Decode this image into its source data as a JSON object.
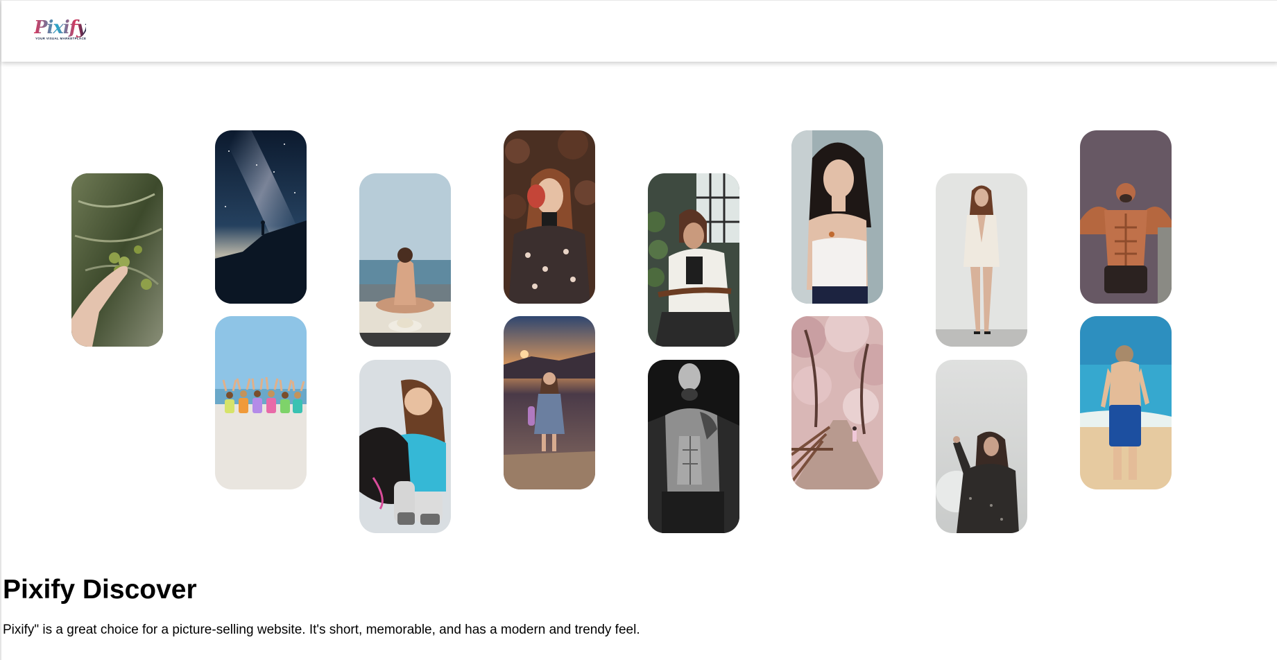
{
  "header": {
    "logo_text": "Pixify",
    "logo_tagline": "YOUR VISUAL MARKETPLACE",
    "logo_icon": "pixify-logo"
  },
  "gallery": {
    "photos": [
      {
        "name": "photo-olive-hand",
        "depicts": "hand holding olives"
      },
      {
        "name": "photo-milky-way",
        "depicts": "person under starry sky"
      },
      {
        "name": "photo-beach-kids",
        "depicts": "children raising arms on beach"
      },
      {
        "name": "photo-woman-beach-hat",
        "depicts": "woman sitting on beach with hat"
      },
      {
        "name": "photo-girl-dog",
        "depicts": "girl hugging dog"
      },
      {
        "name": "photo-woman-leaf",
        "depicts": "woman holding red leaf"
      },
      {
        "name": "photo-girl-field-sunset",
        "depicts": "little girl in field at sunset"
      },
      {
        "name": "photo-woman-chair",
        "depicts": "woman sitting in chair by window"
      },
      {
        "name": "photo-man-tattoo-bw",
        "depicts": "black and white tattooed man"
      },
      {
        "name": "photo-woman-portrait",
        "depicts": "woman portrait in lace top"
      },
      {
        "name": "photo-cherry-blossom-path",
        "depicts": "cherry blossom path"
      },
      {
        "name": "photo-woman-blazer",
        "depicts": "woman in white blazer standing"
      },
      {
        "name": "photo-woman-snow",
        "depicts": "woman in snow"
      },
      {
        "name": "photo-muscular-man",
        "depicts": "muscular man flexing"
      },
      {
        "name": "photo-boy-beach",
        "depicts": "boy standing on beach"
      }
    ]
  },
  "main": {
    "title": "Pixify Discover",
    "description": "Pixify\" is a great choice for a picture-selling website. It's short, memorable, and has a modern and trendy feel."
  },
  "colors": {
    "header_bg": "#ffffff",
    "page_bg": "#ffffff",
    "text": "#000000",
    "logo_pink": "#d8335b",
    "logo_cyan": "#2aa7c9"
  }
}
